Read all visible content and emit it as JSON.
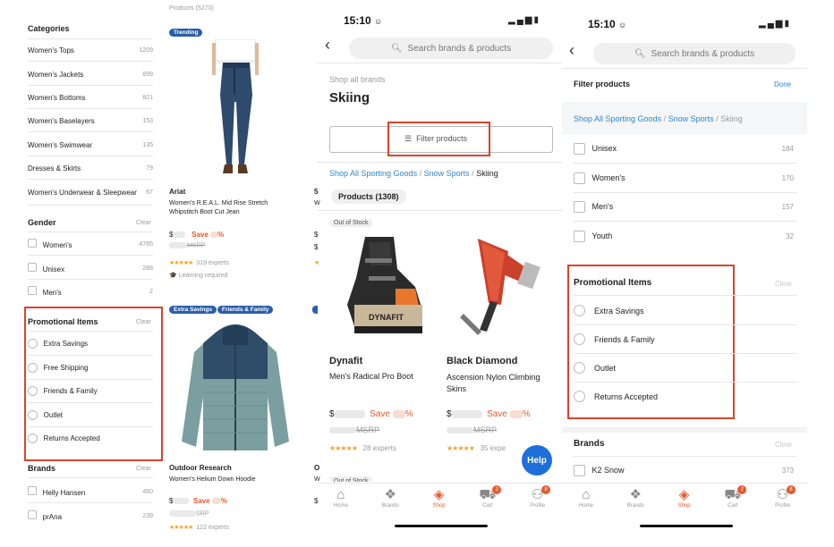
{
  "left": {
    "categories_title": "Categories",
    "categories": [
      {
        "label": "Women's Tops",
        "count": "1209"
      },
      {
        "label": "Women's Jackets",
        "count": "899"
      },
      {
        "label": "Women's Bottoms",
        "count": "821"
      },
      {
        "label": "Women's Baselayers",
        "count": "153"
      },
      {
        "label": "Women's Swimwear",
        "count": "135"
      },
      {
        "label": "Dresses & Skirts",
        "count": "79"
      },
      {
        "label": "Women's Underwear & Sleepwear",
        "count": "67"
      }
    ],
    "gender_title": "Gender",
    "clear": "Clear",
    "gender": [
      {
        "label": "Women's",
        "count": "4765"
      },
      {
        "label": "Unisex",
        "count": "288"
      },
      {
        "label": "Men's",
        "count": "2"
      }
    ],
    "promo_title": "Promotional Items",
    "promo": [
      "Extra Savings",
      "Free Shipping",
      "Friends & Family",
      "Outlet",
      "Returns Accepted"
    ],
    "brands_title": "Brands",
    "brands": [
      {
        "label": "Helly Hansen",
        "count": "460"
      },
      {
        "label": "prAna",
        "count": "239"
      }
    ]
  },
  "products_left": {
    "top_text": "Products (5270)",
    "trending": "Trending",
    "p1_brand": "Ariat",
    "p1_name": "Women's R.E.A.L. Mid Rise Stretch Whipstitch Boot Cut Jean",
    "p1_price_prefix": "$",
    "p1_save": "Save",
    "p1_save_suffix": "%",
    "p1_msrp": "MSRP",
    "p1_stars": "★★★★★",
    "p1_experts": "319 experts",
    "p1_learning": "Learning required",
    "badge_extra": "Extra Savings",
    "badge_ff": "Friends & Family",
    "p2_brand": "Outdoor Research",
    "p2_name": "Women's Helium Down Hoodie",
    "p2_price_prefix": "$",
    "p2_save": "Save",
    "p2_save_suffix": "%",
    "p2_msrp": "SRP",
    "p2_stars": "★★★★★",
    "p2_experts": "122 experts",
    "col2_letters": [
      "5",
      "W",
      "$",
      "$",
      "★",
      "O",
      "W",
      "$"
    ]
  },
  "middle": {
    "time": "15:10",
    "search_placeholder": "Search brands & products",
    "shop_all": "Shop all brands",
    "title": "Skiing",
    "filter_btn": "Filter products",
    "crumb1": "Shop All Sporting Goods",
    "crumb2": "Snow Sports",
    "crumb3": "Skiing",
    "sep": "/",
    "products_count": "Products (1308)",
    "out_of_stock": "Out of Stock",
    "item1_brand": "Dynafit",
    "item1_name": "Men's Radical Pro Boot",
    "item1_stars": "★★★★★",
    "item1_experts": "28 experts",
    "item2_brand": "Black Diamond",
    "item2_name": "Ascension Nylon Climbing Skins",
    "item2_stars": "★★★★★",
    "item2_experts": "35 expe",
    "price_prefix": "$",
    "save": "Save",
    "save_suffix": "%",
    "msrp": "MSRP",
    "help": "Help",
    "out_of_stock2": "Out of Stock"
  },
  "right": {
    "time": "15:10",
    "search_placeholder": "Search brands & products",
    "filter_title": "Filter products",
    "done": "Done",
    "crumb1": "Shop All Sporting Goods",
    "crumb2": "Snow Sports",
    "crumb3": "Skiing",
    "sep": "/",
    "gender": [
      {
        "label": "Unisex",
        "count": "184"
      },
      {
        "label": "Women's",
        "count": "170"
      },
      {
        "label": "Men's",
        "count": "157"
      },
      {
        "label": "Youth",
        "count": "32"
      }
    ],
    "promo_title": "Promotional Items",
    "clear": "Clear",
    "promo": [
      "Extra Savings",
      "Friends & Family",
      "Outlet",
      "Returns Accepted"
    ],
    "brands_title": "Brands",
    "brands": [
      {
        "label": "K2 Snow",
        "count": "373"
      }
    ]
  },
  "nav": {
    "home": "Home",
    "brands": "Brands",
    "shop": "Shop",
    "cart": "Cart",
    "profile": "Profile",
    "cart_badge": "2",
    "profile_badge": "8"
  },
  "colors": {
    "accent": "#e8572d",
    "link": "#2f86c9",
    "highlight": "#d9432b"
  }
}
